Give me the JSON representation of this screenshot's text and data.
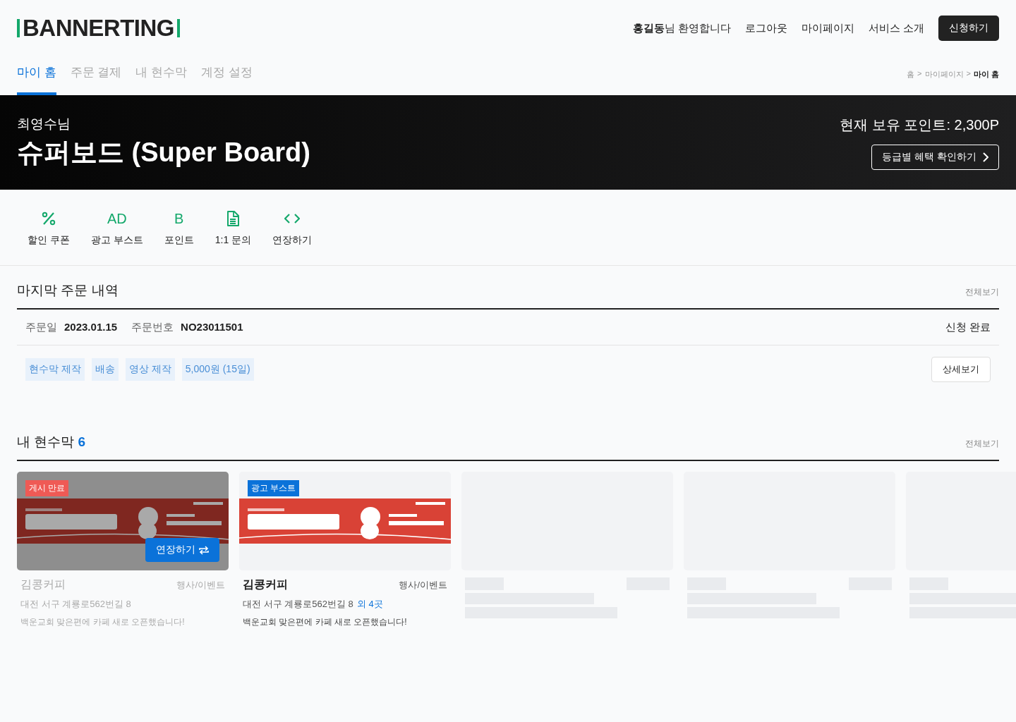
{
  "header": {
    "logo": "BANNERTING",
    "welcome": "**홍길동**님 환영합니다",
    "links": [
      "로그아웃",
      "마이페이지",
      "서비스 소개"
    ],
    "cta": "신청하기"
  },
  "tabs": [
    {
      "label": "마이 홈",
      "selected": true
    },
    {
      "label": "주문 결제",
      "selected": false
    },
    {
      "label": "내 현수막",
      "selected": false
    },
    {
      "label": "계정 설정",
      "selected": false
    }
  ],
  "breadcrumb": {
    "separator": ">",
    "items": [
      {
        "label": "홈",
        "current": false
      },
      {
        "label": "마이페이지",
        "current": false
      },
      {
        "label": "마이 홈",
        "current": true
      }
    ]
  },
  "hero": {
    "greeting": "최영수님",
    "grade": "슈퍼보드 (Super Board)",
    "points": "현재 보유 포인트: 2,300P",
    "benefits_button": "등급별 혜택 확인하기"
  },
  "quick_menu": [
    {
      "kind": "percent",
      "label": "할인 쿠폰"
    },
    {
      "kind": "glyph",
      "glyph": "AD",
      "label": "광고 부스트"
    },
    {
      "kind": "glyph",
      "glyph": "B",
      "label": "포인트"
    },
    {
      "kind": "document",
      "label": "1:1 문의"
    },
    {
      "kind": "code",
      "label": "연장하기"
    }
  ],
  "last_order": {
    "title": "마지막 주문 내역",
    "view_all": "전체보기",
    "date_label": "주문일",
    "date": "2023.01.15",
    "number_label": "주문번호",
    "number": "NO23011501",
    "status": "신청 완료",
    "tags": [
      "현수막 제작",
      "배송",
      "영상 제작",
      "5,000원 (15일)"
    ],
    "detail_button": "상세보기"
  },
  "banners": {
    "title": "내 현수막",
    "count": "6",
    "view_all": "전체보기",
    "items": [
      {
        "kind": "banner",
        "expired": true,
        "badge": "게시 만료",
        "extend_button": "연장하기",
        "name": "김콩커피",
        "category": "행사/이벤트",
        "address": "대전 서구 계룡로562번길 8",
        "description": "백운교회 맞은편에 카페 새로 오픈했습니다!"
      },
      {
        "kind": "banner",
        "expired": false,
        "badge": "광고 부스트",
        "name": "김콩커피",
        "category": "행사/이벤트",
        "address": "대전 서구 계룡로562번길 8",
        "extra": "외 4곳",
        "description": "백운교회 맞은편에 카페 새로 오픈했습니다!"
      },
      {
        "kind": "placeholder"
      },
      {
        "kind": "placeholder"
      },
      {
        "kind": "placeholder"
      }
    ]
  }
}
